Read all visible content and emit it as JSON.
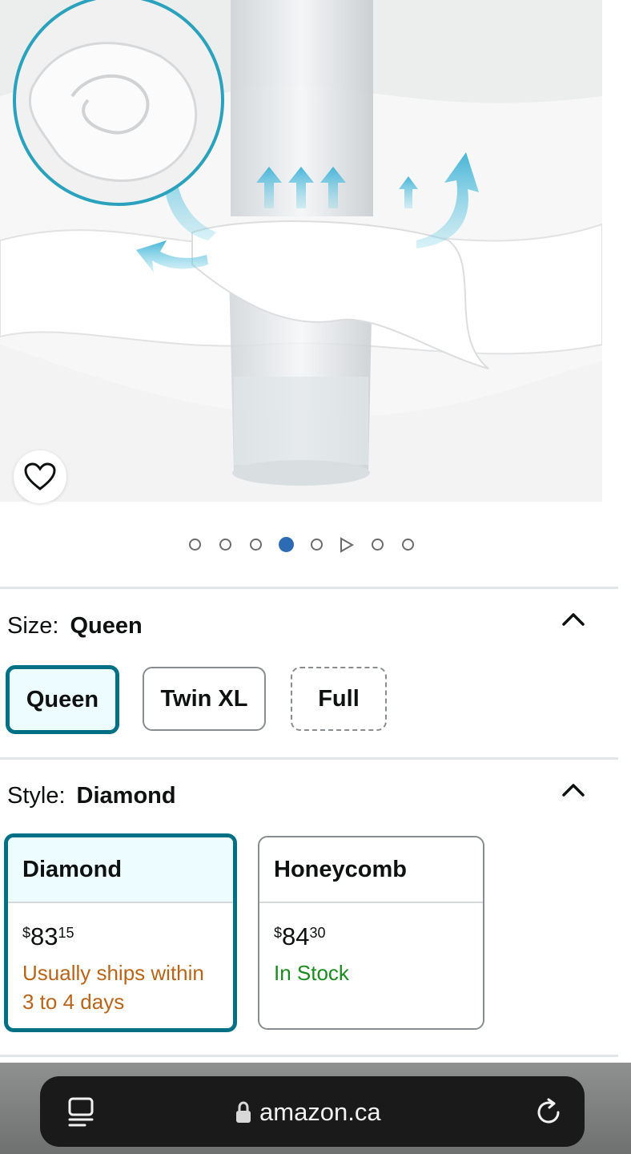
{
  "product_image": {
    "wishlist_icon": "heart-outline-icon",
    "carousel": {
      "total": 8,
      "active_index": 3,
      "video_index": 5
    }
  },
  "size": {
    "label": "Size:",
    "selected": "Queen",
    "toggle_icon": "chevron-up-icon",
    "options": [
      {
        "label": "Queen",
        "state": "selected"
      },
      {
        "label": "Twin XL",
        "state": "available"
      },
      {
        "label": "Full",
        "state": "unavailable"
      }
    ]
  },
  "style": {
    "label": "Style:",
    "selected": "Diamond",
    "toggle_icon": "chevron-up-icon",
    "options": [
      {
        "name": "Diamond",
        "currency": "$",
        "price_whole": "83",
        "price_fraction": "15",
        "availability_line1": "Usually ships within",
        "availability_line2": "3 to 4 days",
        "availability_color": "#b8651a",
        "state": "selected"
      },
      {
        "name": "Honeycomb",
        "currency": "$",
        "price_whole": "84",
        "price_fraction": "30",
        "availability_line1": "In Stock",
        "availability_line2": "",
        "availability_color": "#1b8a1f",
        "state": "available"
      }
    ]
  },
  "browser": {
    "url": "amazon.ca",
    "tabs_icon": "tabs-icon",
    "lock_icon": "lock-icon",
    "reload_icon": "reload-icon"
  },
  "colors": {
    "accent": "#007185",
    "selected_bg": "#edfdff",
    "active_dot": "#2e6bb5"
  }
}
